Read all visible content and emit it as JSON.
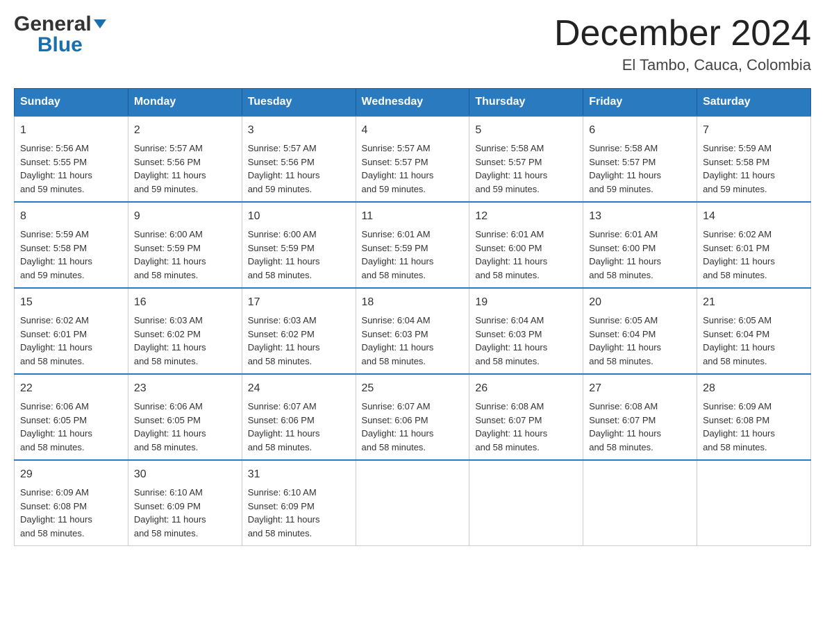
{
  "header": {
    "logo_general": "General",
    "logo_blue": "Blue",
    "month_title": "December 2024",
    "location": "El Tambo, Cauca, Colombia"
  },
  "calendar": {
    "headers": [
      "Sunday",
      "Monday",
      "Tuesday",
      "Wednesday",
      "Thursday",
      "Friday",
      "Saturday"
    ],
    "weeks": [
      [
        {
          "day": "1",
          "sunrise": "5:56 AM",
          "sunset": "5:55 PM",
          "daylight": "11 hours and 59 minutes."
        },
        {
          "day": "2",
          "sunrise": "5:57 AM",
          "sunset": "5:56 PM",
          "daylight": "11 hours and 59 minutes."
        },
        {
          "day": "3",
          "sunrise": "5:57 AM",
          "sunset": "5:56 PM",
          "daylight": "11 hours and 59 minutes."
        },
        {
          "day": "4",
          "sunrise": "5:57 AM",
          "sunset": "5:57 PM",
          "daylight": "11 hours and 59 minutes."
        },
        {
          "day": "5",
          "sunrise": "5:58 AM",
          "sunset": "5:57 PM",
          "daylight": "11 hours and 59 minutes."
        },
        {
          "day": "6",
          "sunrise": "5:58 AM",
          "sunset": "5:57 PM",
          "daylight": "11 hours and 59 minutes."
        },
        {
          "day": "7",
          "sunrise": "5:59 AM",
          "sunset": "5:58 PM",
          "daylight": "11 hours and 59 minutes."
        }
      ],
      [
        {
          "day": "8",
          "sunrise": "5:59 AM",
          "sunset": "5:58 PM",
          "daylight": "11 hours and 59 minutes."
        },
        {
          "day": "9",
          "sunrise": "6:00 AM",
          "sunset": "5:59 PM",
          "daylight": "11 hours and 58 minutes."
        },
        {
          "day": "10",
          "sunrise": "6:00 AM",
          "sunset": "5:59 PM",
          "daylight": "11 hours and 58 minutes."
        },
        {
          "day": "11",
          "sunrise": "6:01 AM",
          "sunset": "5:59 PM",
          "daylight": "11 hours and 58 minutes."
        },
        {
          "day": "12",
          "sunrise": "6:01 AM",
          "sunset": "6:00 PM",
          "daylight": "11 hours and 58 minutes."
        },
        {
          "day": "13",
          "sunrise": "6:01 AM",
          "sunset": "6:00 PM",
          "daylight": "11 hours and 58 minutes."
        },
        {
          "day": "14",
          "sunrise": "6:02 AM",
          "sunset": "6:01 PM",
          "daylight": "11 hours and 58 minutes."
        }
      ],
      [
        {
          "day": "15",
          "sunrise": "6:02 AM",
          "sunset": "6:01 PM",
          "daylight": "11 hours and 58 minutes."
        },
        {
          "day": "16",
          "sunrise": "6:03 AM",
          "sunset": "6:02 PM",
          "daylight": "11 hours and 58 minutes."
        },
        {
          "day": "17",
          "sunrise": "6:03 AM",
          "sunset": "6:02 PM",
          "daylight": "11 hours and 58 minutes."
        },
        {
          "day": "18",
          "sunrise": "6:04 AM",
          "sunset": "6:03 PM",
          "daylight": "11 hours and 58 minutes."
        },
        {
          "day": "19",
          "sunrise": "6:04 AM",
          "sunset": "6:03 PM",
          "daylight": "11 hours and 58 minutes."
        },
        {
          "day": "20",
          "sunrise": "6:05 AM",
          "sunset": "6:04 PM",
          "daylight": "11 hours and 58 minutes."
        },
        {
          "day": "21",
          "sunrise": "6:05 AM",
          "sunset": "6:04 PM",
          "daylight": "11 hours and 58 minutes."
        }
      ],
      [
        {
          "day": "22",
          "sunrise": "6:06 AM",
          "sunset": "6:05 PM",
          "daylight": "11 hours and 58 minutes."
        },
        {
          "day": "23",
          "sunrise": "6:06 AM",
          "sunset": "6:05 PM",
          "daylight": "11 hours and 58 minutes."
        },
        {
          "day": "24",
          "sunrise": "6:07 AM",
          "sunset": "6:06 PM",
          "daylight": "11 hours and 58 minutes."
        },
        {
          "day": "25",
          "sunrise": "6:07 AM",
          "sunset": "6:06 PM",
          "daylight": "11 hours and 58 minutes."
        },
        {
          "day": "26",
          "sunrise": "6:08 AM",
          "sunset": "6:07 PM",
          "daylight": "11 hours and 58 minutes."
        },
        {
          "day": "27",
          "sunrise": "6:08 AM",
          "sunset": "6:07 PM",
          "daylight": "11 hours and 58 minutes."
        },
        {
          "day": "28",
          "sunrise": "6:09 AM",
          "sunset": "6:08 PM",
          "daylight": "11 hours and 58 minutes."
        }
      ],
      [
        {
          "day": "29",
          "sunrise": "6:09 AM",
          "sunset": "6:08 PM",
          "daylight": "11 hours and 58 minutes."
        },
        {
          "day": "30",
          "sunrise": "6:10 AM",
          "sunset": "6:09 PM",
          "daylight": "11 hours and 58 minutes."
        },
        {
          "day": "31",
          "sunrise": "6:10 AM",
          "sunset": "6:09 PM",
          "daylight": "11 hours and 58 minutes."
        },
        null,
        null,
        null,
        null
      ]
    ],
    "labels": {
      "sunrise": "Sunrise:",
      "sunset": "Sunset:",
      "daylight": "Daylight:"
    }
  }
}
